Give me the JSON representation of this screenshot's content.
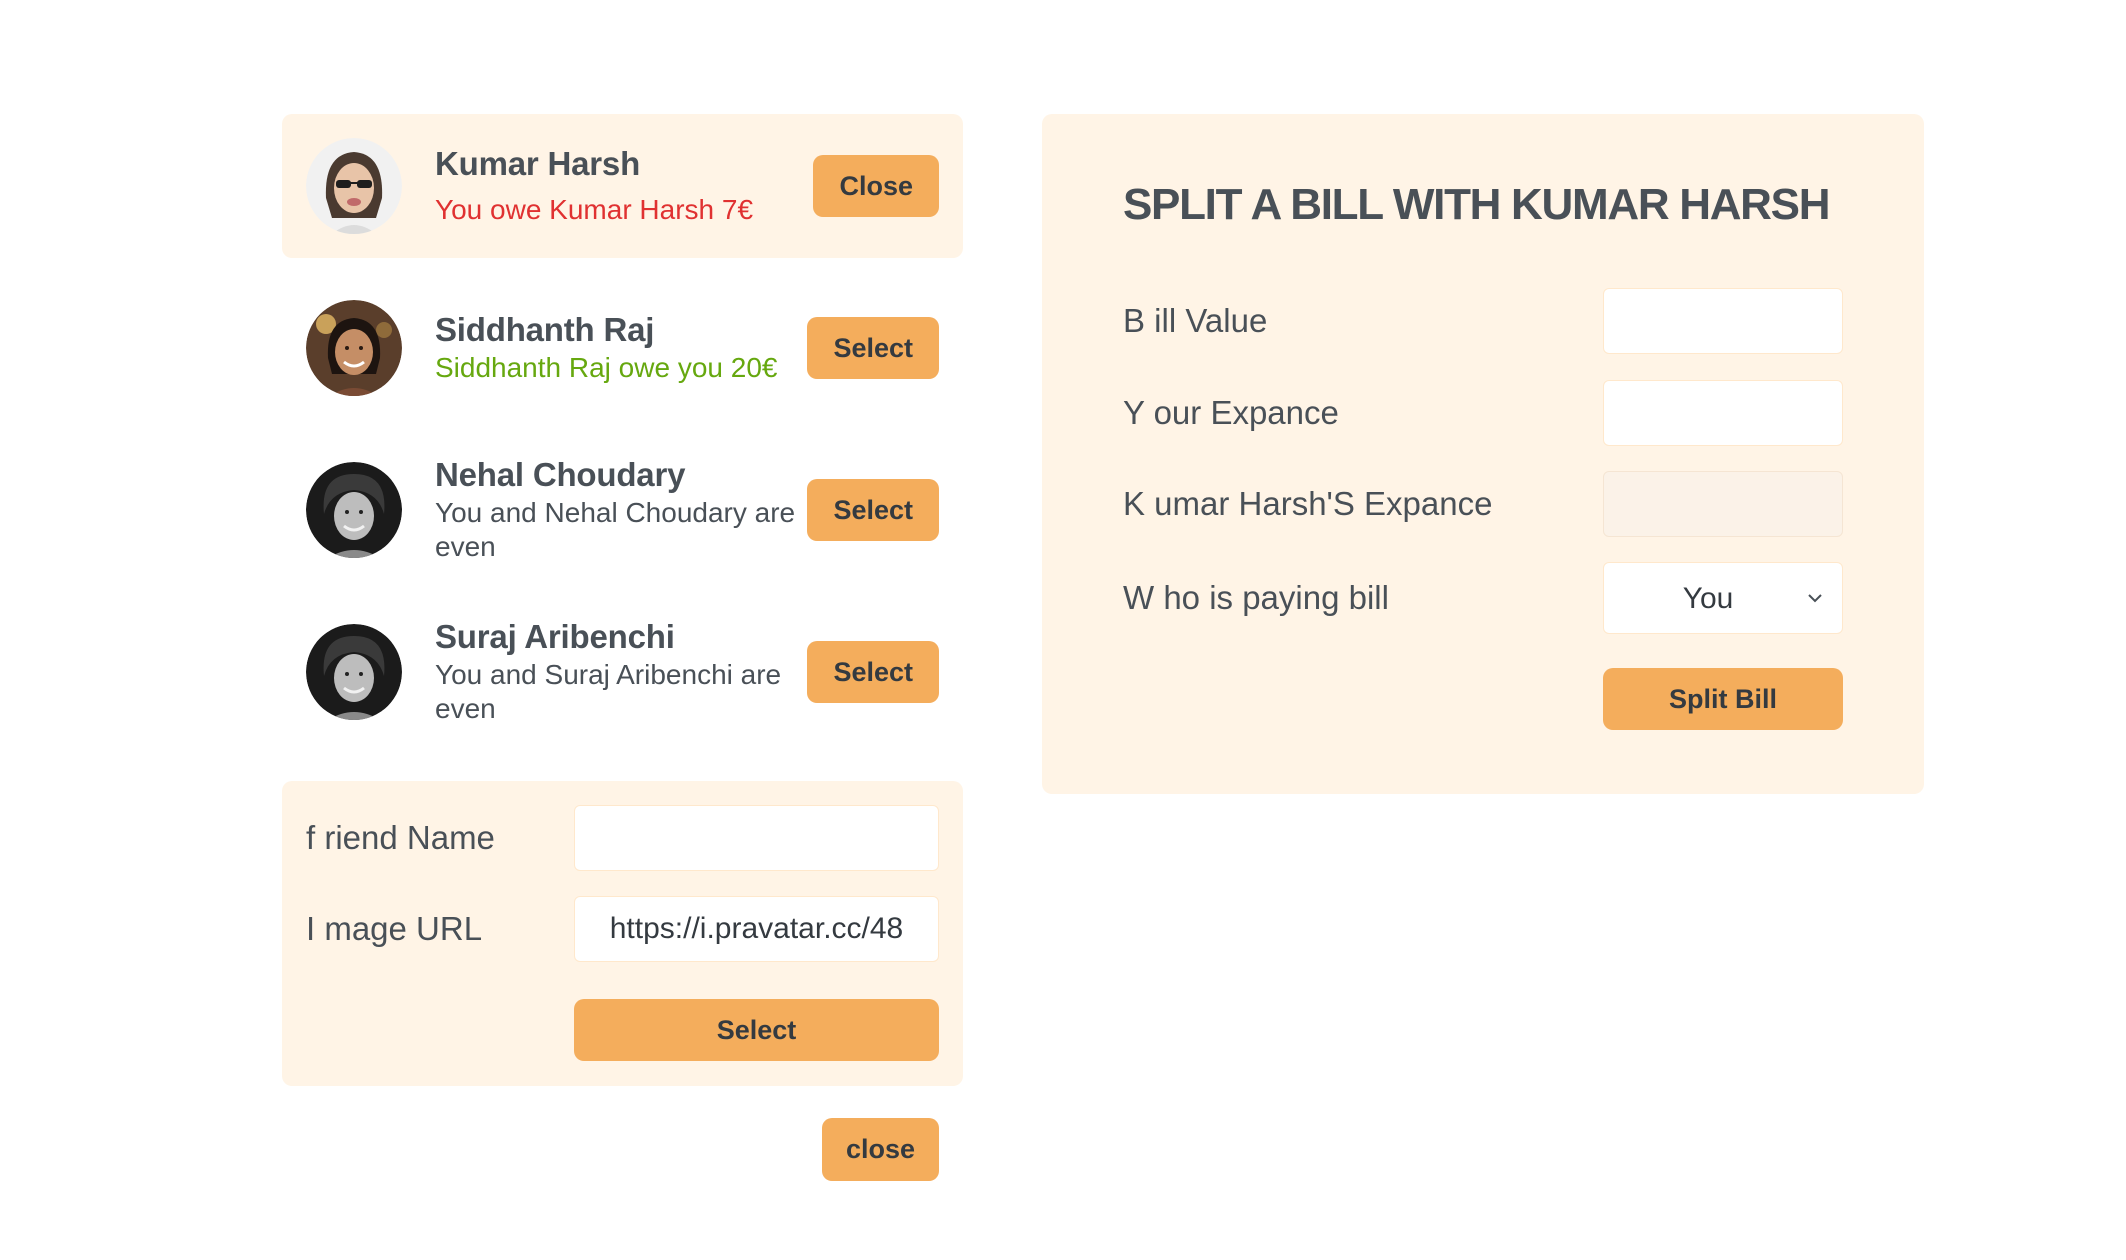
{
  "friends": [
    {
      "name": "Kumar Harsh",
      "status": "You owe Kumar Harsh 7€",
      "status_kind": "negative",
      "button_label": "Close",
      "selected": true
    },
    {
      "name": "Siddhanth Raj",
      "status": "Siddhanth Raj owe you 20€",
      "status_kind": "positive",
      "button_label": "Select",
      "selected": false
    },
    {
      "name": "Nehal Choudary",
      "status": "You and Nehal Choudary are even",
      "status_kind": "even",
      "button_label": "Select",
      "selected": false
    },
    {
      "name": "Suraj Aribenchi",
      "status": "You and Suraj Aribenchi are even",
      "status_kind": "even",
      "button_label": "Select",
      "selected": false
    }
  ],
  "add_friend": {
    "name_label": "f riend Name",
    "name_value": "",
    "image_label": "I mage URL",
    "image_value": "https://i.pravatar.cc/48",
    "submit_label": "Select"
  },
  "close_form_label": "close",
  "split_bill": {
    "title": "SPLIT A BILL WITH KUMAR HARSH",
    "bill_label": "B ill Value",
    "bill_value": "",
    "expense_label": "Y our Expance",
    "expense_value": "",
    "friend_expense_label": "K umar Harsh'S Expance",
    "friend_expense_value": "",
    "payer_label": "W ho is paying bill",
    "payer_value": "You",
    "submit_label": "Split Bill"
  },
  "colors": {
    "accent": "#f4ad5c",
    "panel": "#fff4e6",
    "text": "#495057",
    "negative": "#e03131",
    "positive": "#66a80f"
  }
}
